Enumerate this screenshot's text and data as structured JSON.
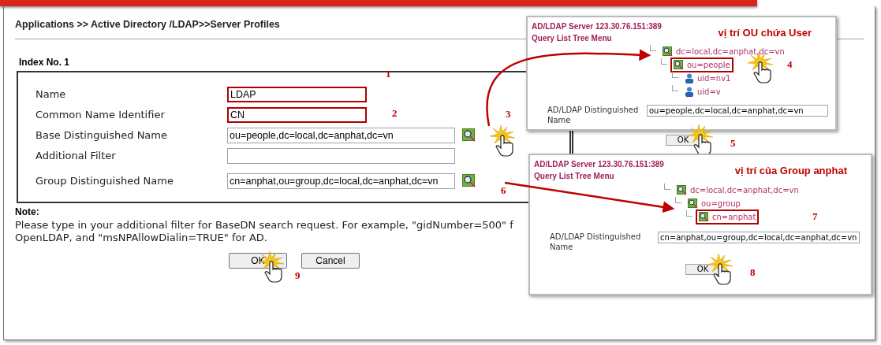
{
  "breadcrumb": "Applications >> Active Directory /LDAP>>Server Profiles",
  "section_title": "Index No. 1",
  "fields": [
    {
      "label": "Name",
      "value": "LDAP",
      "highlighted": true,
      "browse": false,
      "clicked": false,
      "callout": "1"
    },
    {
      "label": "Common Name Identifier",
      "value": "CN",
      "highlighted": true,
      "browse": false,
      "clicked": false,
      "callout": "2"
    },
    {
      "label": "Base Distinguished Name",
      "value": "ou=people,dc=local,dc=anphat,dc=vn",
      "highlighted": false,
      "browse": true,
      "clicked": true,
      "callout": "3"
    },
    {
      "label": "Additional Filter",
      "highlighted": false,
      "browse": false,
      "clicked": false
    },
    {
      "label": "Group Distinguished Name",
      "value": "cn=anphat,ou=group,dc=local,dc=anphat,dc=vn",
      "highlighted": false,
      "browse": true,
      "clicked": false,
      "callout": "6"
    }
  ],
  "note": {
    "title": "Note:",
    "lines": [
      "Please type in your additional filter for BaseDN search request. For example, \"gidNumber=500\" f",
      "OpenLDAP, and \"msNPAllowDialin=TRUE\" for AD."
    ]
  },
  "buttons": [
    {
      "label": "OK",
      "clicked": true,
      "callout": "9"
    },
    {
      "label": "Cancel",
      "clicked": false
    }
  ],
  "popups": [
    {
      "server": "AD/LDAP Server 123.30.76.151:389",
      "subtitle": "Query List Tree Menu",
      "caption": "vị trí OU chứa User",
      "tree": [
        {
          "label": "dc=local,dc=anphat,dc=vn",
          "kind": "container",
          "selected": false,
          "children": [
            {
              "label": "ou=people",
              "kind": "container",
              "selected": true,
              "clicked": true,
              "callout": "4",
              "children": [
                {
                  "label": "uid=nv1",
                  "kind": "user",
                  "selected": false
                },
                {
                  "label": "uid=v",
                  "kind": "user",
                  "selected": false
                }
              ]
            }
          ]
        }
      ],
      "dn_label": "AD/LDAP Distinguished Name",
      "dn_value": "ou=people,dc=local,dc=anphat,dc=vn",
      "ok": {
        "label": "OK",
        "clicked": true,
        "callout": "5"
      }
    },
    {
      "server": "AD/LDAP Server 123.30.76.151:389",
      "subtitle": "Query List Tree Menu",
      "caption": "vị trí của Group anphat",
      "tree": [
        {
          "label": "dc=local,dc=anphat,dc=vn",
          "kind": "container",
          "selected": false,
          "children": [
            {
              "label": "ou=group",
              "kind": "container",
              "selected": false,
              "children": [
                {
                  "label": "cn=anphat",
                  "kind": "container",
                  "selected": true,
                  "clicked": false,
                  "callout": "7"
                }
              ]
            }
          ]
        }
      ],
      "dn_label": "AD/LDAP Distinguished Name",
      "dn_value": "cn=anphat,ou=group,dc=local,dc=anphat,dc=vn",
      "ok": {
        "label": "OK",
        "clicked": true,
        "callout": "8"
      }
    }
  ]
}
